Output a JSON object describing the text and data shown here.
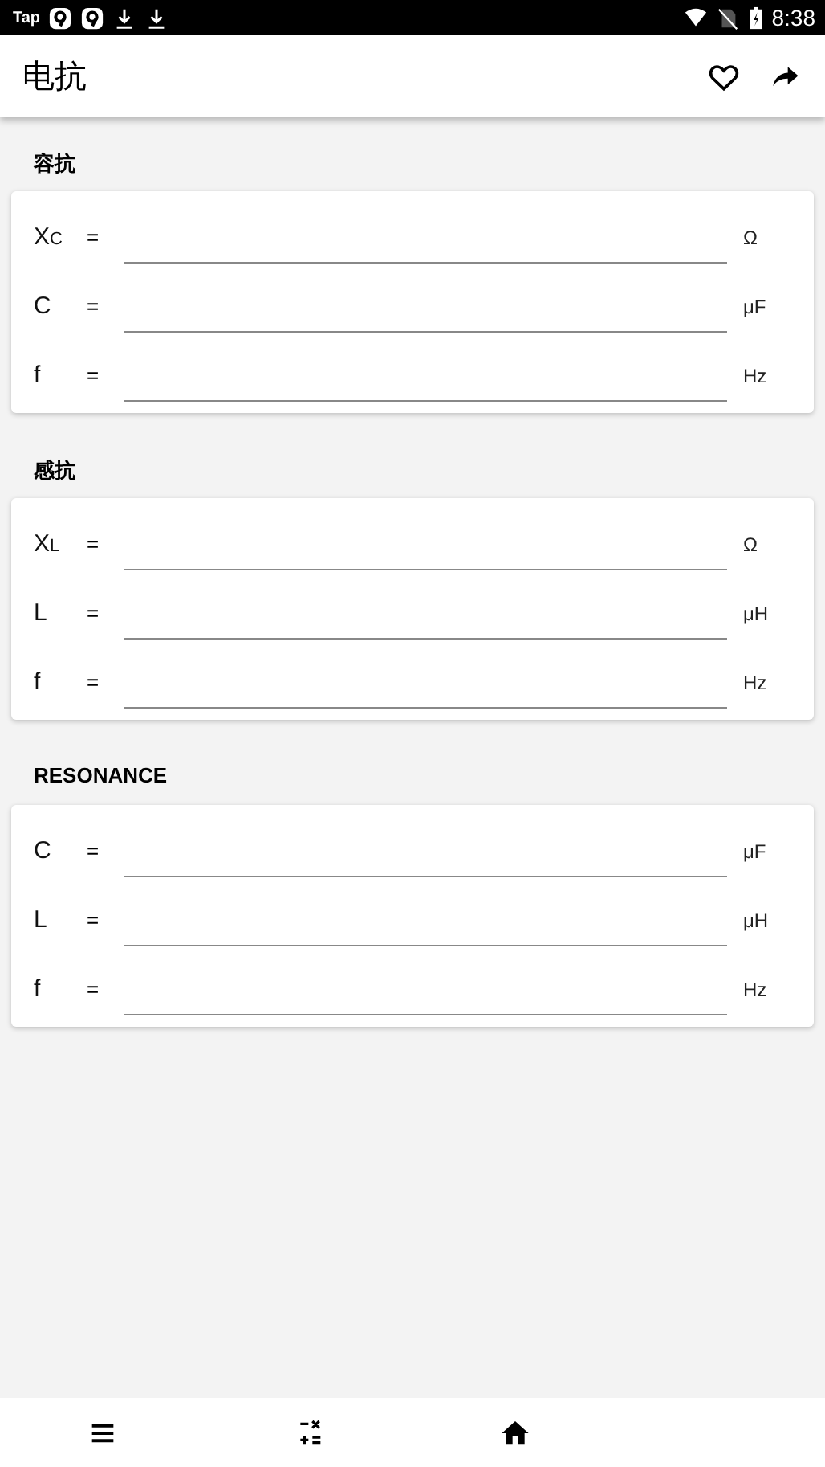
{
  "status_bar": {
    "carrier": "Tap",
    "time": "8:38"
  },
  "app_bar": {
    "title": "电抗"
  },
  "sections": [
    {
      "title": "容抗",
      "rows": [
        {
          "symbol": "X$_{C}$",
          "unit": "Ω"
        },
        {
          "symbol": "C",
          "unit": "μF"
        },
        {
          "symbol": "f",
          "unit": "Hz"
        }
      ]
    },
    {
      "title": "感抗",
      "rows": [
        {
          "symbol": "X$_{L}$",
          "unit": "Ω"
        },
        {
          "symbol": "L",
          "unit": "μH"
        },
        {
          "symbol": "f",
          "unit": "Hz"
        }
      ]
    },
    {
      "title": "RESONANCE",
      "rows": [
        {
          "symbol": "C",
          "unit": "μF"
        },
        {
          "symbol": "L",
          "unit": "μH"
        },
        {
          "symbol": "f",
          "unit": "Hz"
        }
      ]
    }
  ],
  "equals": "=",
  "bottom_nav": [
    {
      "kind": "menu"
    },
    {
      "kind": "calculator"
    },
    {
      "kind": "home"
    }
  ]
}
